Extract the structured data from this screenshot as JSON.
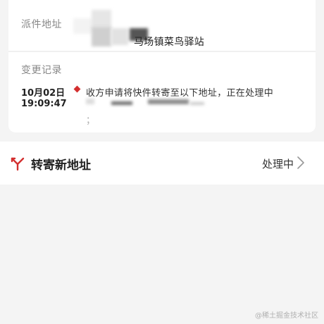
{
  "detail_card": {
    "dispatch_label": "派件地址",
    "dispatch_address_visible": "马场镇菜鸟驿站",
    "change_log_label": "变更记录",
    "change_entry": {
      "date": "10月02日",
      "time": "19:09:47",
      "description": "收方申请将快件转寄至以下地址，正在处理中",
      "tail": "；"
    }
  },
  "forward_row": {
    "icon": "fork-icon",
    "title": "转寄新地址",
    "status": "处理中",
    "chevron": "chevron-right-icon"
  },
  "watermark": "@稀土掘金技术社区",
  "colors": {
    "accent": "#d32f2f",
    "background": "#f4f4f4",
    "card": "#ffffff"
  }
}
